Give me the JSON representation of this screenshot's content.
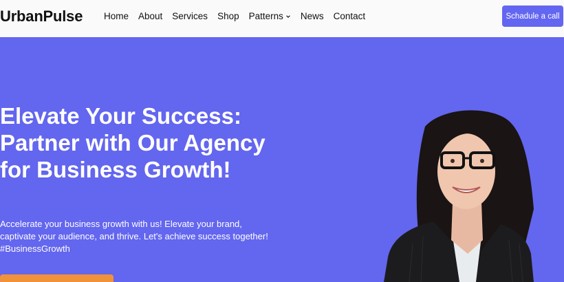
{
  "brand": {
    "logo_text": "UrbanPulse"
  },
  "nav": {
    "items": [
      {
        "label": "Home"
      },
      {
        "label": "About"
      },
      {
        "label": "Services"
      },
      {
        "label": "Shop"
      },
      {
        "label": "Patterns",
        "has_dropdown": true
      },
      {
        "label": "News"
      },
      {
        "label": "Contact"
      }
    ],
    "cta_label": "Schadule a call"
  },
  "hero": {
    "headline": "Elevate Your Success: Partner with Our Agency for Business Growth!",
    "subtext": "Accelerate your business growth with us! Elevate your brand, captivate your audience, and thrive. Let's achieve success together! #BusinessGrowth",
    "image_icon": "woman-portrait"
  },
  "colors": {
    "accent": "#6366f1",
    "hero_bg": "#6366ee",
    "button_orange": "#f0923a",
    "text_dark": "#111111",
    "header_bg": "#fafafa"
  }
}
